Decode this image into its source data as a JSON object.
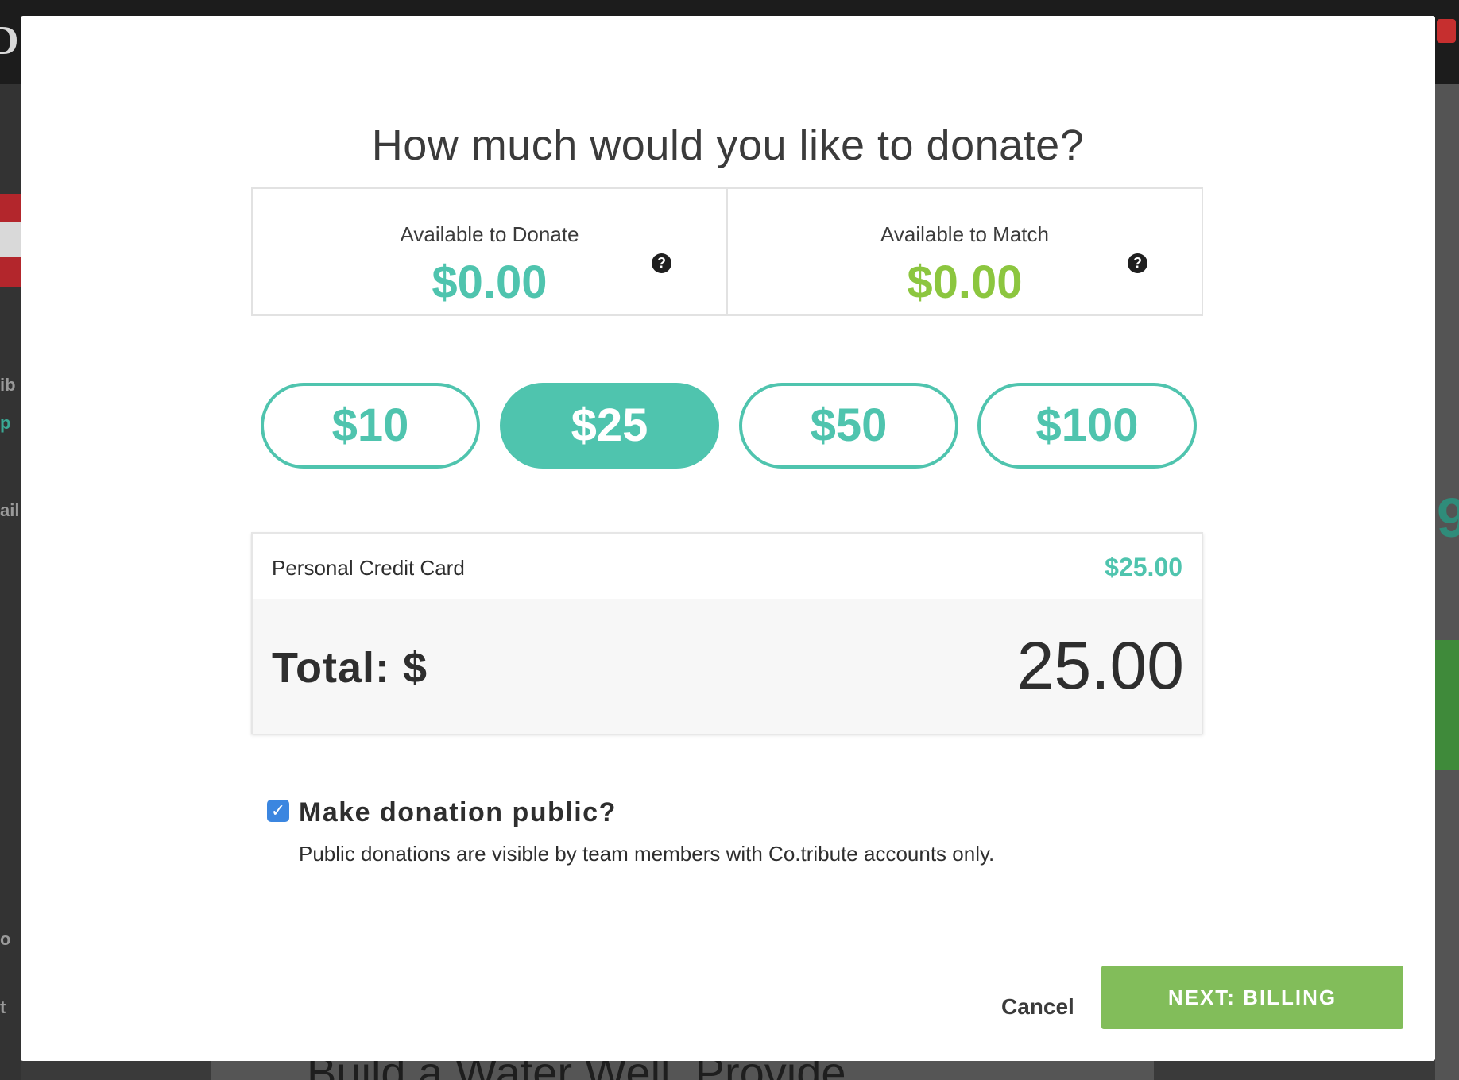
{
  "modal": {
    "title": "How much would you like to donate?",
    "balances": {
      "donate": {
        "label": "Available to Donate",
        "value": "$0.00"
      },
      "match": {
        "label": "Available to Match",
        "value": "$0.00"
      },
      "help_glyph": "?"
    },
    "amount_options": [
      {
        "label": "$10",
        "selected": false
      },
      {
        "label": "$25",
        "selected": true
      },
      {
        "label": "$50",
        "selected": false
      },
      {
        "label": "$100",
        "selected": false
      }
    ],
    "summary": {
      "method_label": "Personal Credit Card",
      "method_amount": "$25.00",
      "total_label": "Total: $",
      "total_value": "25.00"
    },
    "public": {
      "checked": true,
      "check_glyph": "✓",
      "label": "Make donation public?",
      "note": "Public donations are visible by team members with Co.tribute accounts only."
    },
    "footer": {
      "cancel_label": "Cancel",
      "next_label": "NEXT: BILLING"
    }
  },
  "background": {
    "bottom_title": "Build a Water Well, Provide"
  },
  "colors": {
    "teal": "#4fc4ae",
    "green": "#8cc63f",
    "next_button": "#82bd5a",
    "checkbox": "#3b86e0"
  },
  "icons": {
    "help": "question-circle-icon",
    "checkbox": "check-icon"
  }
}
